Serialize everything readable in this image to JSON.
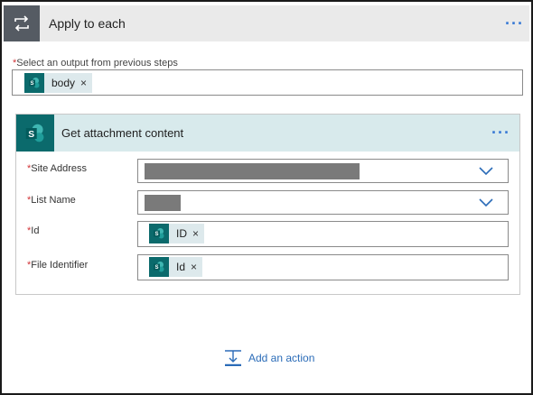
{
  "loop": {
    "title": "Apply to each",
    "more": "···",
    "output_label": "Select an output from previous steps",
    "required_mark": "*",
    "token": {
      "label": "body",
      "remove": "×",
      "icon": "sharepoint-icon"
    }
  },
  "action": {
    "title": "Get attachment content",
    "more": "···",
    "fields": [
      {
        "label": "Site Address",
        "required": "*"
      },
      {
        "label": "List Name",
        "required": "*"
      },
      {
        "label": "Id",
        "required": "*",
        "token": {
          "label": "ID",
          "remove": "×"
        }
      },
      {
        "label": "File Identifier",
        "required": "*",
        "token": {
          "label": "Id",
          "remove": "×"
        }
      }
    ]
  },
  "add_action": {
    "label": "Add an action",
    "icon": "add-action-icon"
  },
  "colors": {
    "accent": "#3a7bd5",
    "sharepoint_teal": "#0b6a6c",
    "card_header": "#d8eaec",
    "loop_header": "#eaeaea",
    "loop_icon_bg": "#555b63",
    "required": "#d13438"
  }
}
